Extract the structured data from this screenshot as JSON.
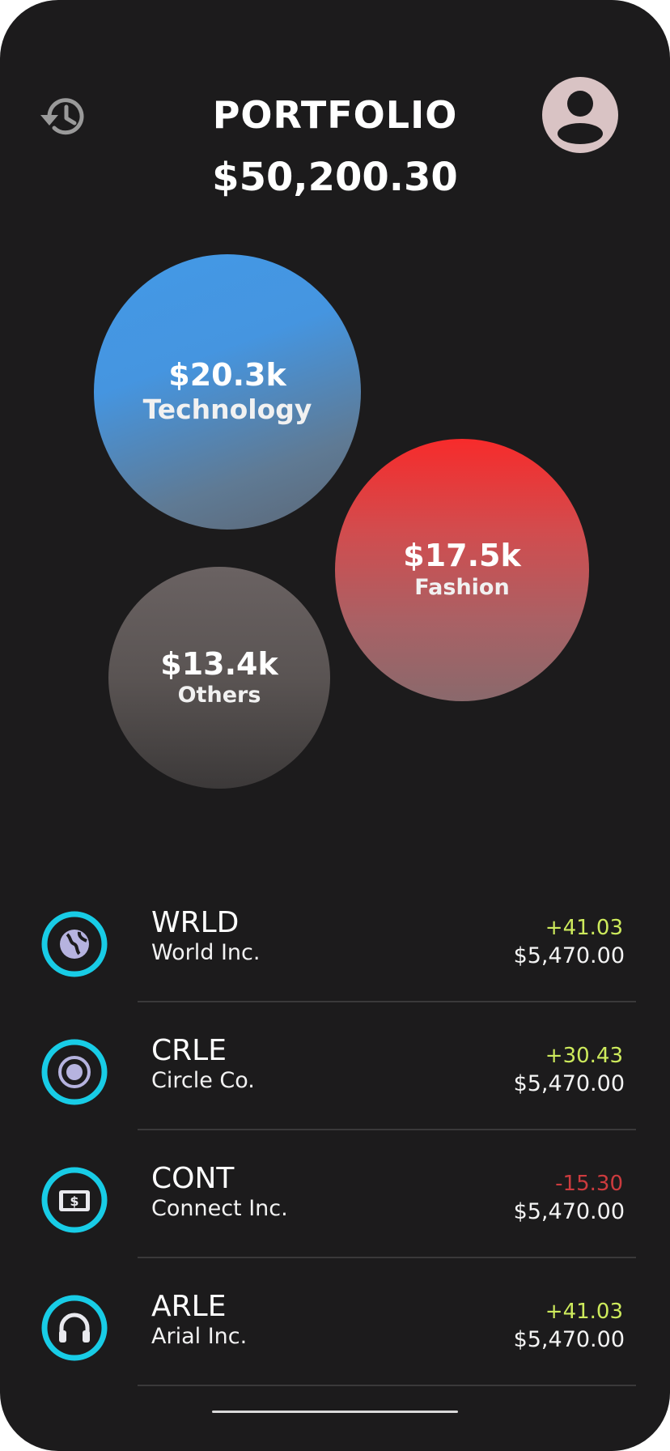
{
  "header": {
    "title": "PORTFOLIO",
    "total_value": "$50,200.30",
    "history_icon": "history-icon",
    "avatar_icon": "user-avatar-icon"
  },
  "bubbles": [
    {
      "amount": "$20.3k",
      "category": "Technology"
    },
    {
      "amount": "$17.5k",
      "category": "Fashion"
    },
    {
      "amount": "$13.4k",
      "category": "Others"
    }
  ],
  "stocks": [
    {
      "ticker": "WRLD",
      "company": "World Inc.",
      "change": "+41.03",
      "price": "$5,470.00",
      "icon": "globe-icon"
    },
    {
      "ticker": "CRLE",
      "company": "Circle Co.",
      "change": "+30.43",
      "price": "$5,470.00",
      "icon": "circle-dot-icon"
    },
    {
      "ticker": "CONT",
      "company": "Connect Inc.",
      "change": "-15.30",
      "price": "$5,470.00",
      "icon": "money-icon"
    },
    {
      "ticker": "ARLE",
      "company": "Arial Inc.",
      "change": "+41.03",
      "price": "$5,470.00",
      "icon": "headphones-icon"
    }
  ],
  "colors": {
    "background": "#1c1b1c",
    "accent_ring": "#18cce6",
    "positive": "#cdea5c",
    "negative": "#cc3b3e",
    "icon_fill": "#b6b3df"
  }
}
